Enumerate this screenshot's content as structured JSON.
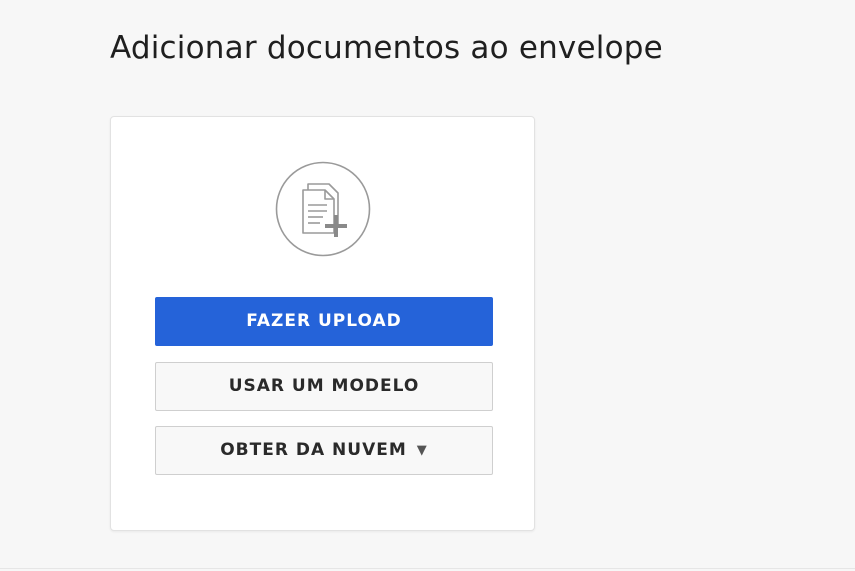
{
  "header": {
    "title": "Adicionar documentos ao envelope"
  },
  "card": {
    "icon": "document-add-icon",
    "buttons": {
      "upload_label": "FAZER UPLOAD",
      "template_label": "USAR UM MODELO",
      "cloud_label": "OBTER DA NUVEM",
      "cloud_caret": "▼"
    }
  },
  "colors": {
    "primary": "#2563d9",
    "page_background": "#f7f7f7"
  }
}
